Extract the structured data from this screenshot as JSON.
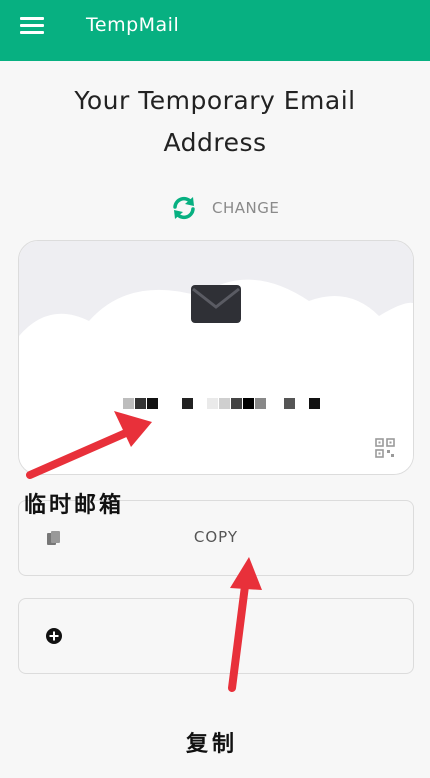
{
  "app": {
    "title": "TempMail"
  },
  "headline": {
    "line1": "Your Temporary Email",
    "line2": "Address"
  },
  "change": {
    "label": "CHANGE",
    "icon": "refresh-icon"
  },
  "email_card": {
    "icon": "mail-icon",
    "address": "",
    "qr_icon": "qr-code-icon"
  },
  "copy": {
    "label": "COPY",
    "icon": "copy-icon"
  },
  "add": {
    "icon": "add-circle-icon"
  },
  "annotations": {
    "temp_mail": "临时邮箱",
    "copy": "复制"
  },
  "colors": {
    "brand": "#07b081",
    "arrow": "#e8303a",
    "background": "#f7f7f7"
  }
}
